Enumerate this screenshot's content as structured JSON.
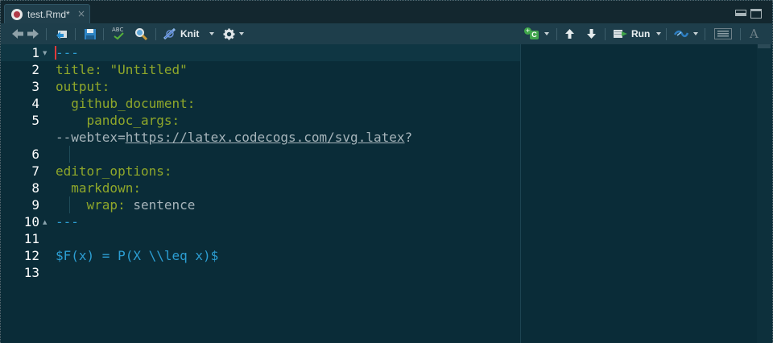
{
  "tab": {
    "title": "test.Rmd*",
    "close": "×"
  },
  "toolbar": {
    "knit_label": "Knit",
    "run_label": "Run",
    "spellcheck_text": "ABC",
    "insert_chunk_letter": "C",
    "format_letter": "A"
  },
  "editor": {
    "line_numbers": [
      "1",
      "2",
      "3",
      "4",
      "5",
      "",
      "6",
      "7",
      "8",
      "9",
      "10",
      "11",
      "12",
      "13"
    ],
    "lines": [
      {
        "segments": [
          {
            "cls": "c-dash",
            "text": "---"
          }
        ]
      },
      {
        "segments": [
          {
            "cls": "c-key",
            "text": "title: "
          },
          {
            "cls": "c-str",
            "text": "\"Untitled\""
          }
        ]
      },
      {
        "segments": [
          {
            "cls": "c-key",
            "text": "output:"
          }
        ]
      },
      {
        "segments": [
          {
            "cls": "c-key",
            "text": "  github_document:"
          }
        ]
      },
      {
        "segments": [
          {
            "cls": "c-key",
            "text": "    pandoc_args:"
          }
        ]
      },
      {
        "segments": [
          {
            "cls": "c-norm",
            "text": "--webtex="
          },
          {
            "cls": "c-url",
            "text": "https://latex.codecogs.com/svg.latex"
          },
          {
            "cls": "c-norm",
            "text": "?"
          }
        ]
      },
      {
        "segments": []
      },
      {
        "segments": [
          {
            "cls": "c-key",
            "text": "editor_options:"
          }
        ]
      },
      {
        "segments": [
          {
            "cls": "c-key",
            "text": "  markdown:"
          }
        ]
      },
      {
        "segments": [
          {
            "cls": "c-key",
            "text": "    wrap: "
          },
          {
            "cls": "c-norm",
            "text": "sentence"
          }
        ]
      },
      {
        "segments": [
          {
            "cls": "c-dash",
            "text": "---"
          }
        ]
      },
      {
        "segments": []
      },
      {
        "segments": [
          {
            "cls": "c-math",
            "text": "$F(x) = P(X \\\\leq x)$"
          }
        ]
      },
      {
        "segments": []
      }
    ]
  },
  "colors": {
    "background": "#0a2c38",
    "yaml_key": "#8fa72a",
    "delimiter": "#2c9ed3",
    "text": "#a6b4ba"
  }
}
